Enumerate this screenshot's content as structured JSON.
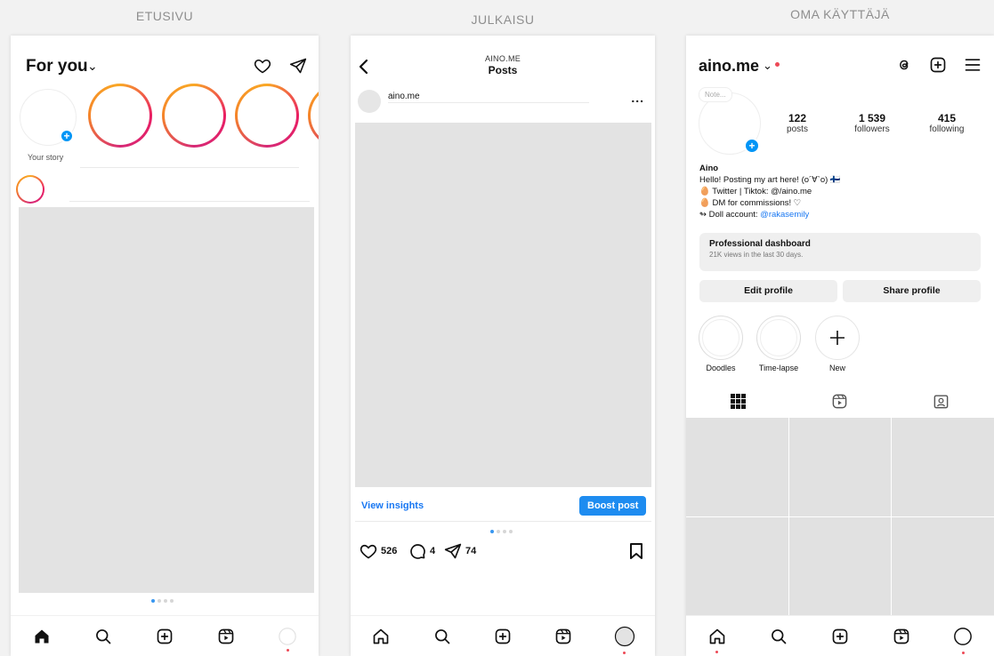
{
  "columns": {
    "home_label": "ETUSIVU",
    "post_label": "JULKAISU",
    "profile_label": "OMA KÄYTTÄJÄ"
  },
  "home": {
    "title": "For you",
    "your_story_label": "Your story",
    "icons": [
      "heart-icon",
      "send-icon",
      "plus-icon"
    ],
    "nav": [
      "home-icon",
      "search-icon",
      "create-icon",
      "reels-icon",
      "profile-icon"
    ]
  },
  "post": {
    "header_small": "AINO.ME",
    "header_big": "Posts",
    "username": "aino.me",
    "menu": "...",
    "view_insights": "View insights",
    "boost_post": "Boost post",
    "likes": "526",
    "comments": "4",
    "shares": "74",
    "accent": "#1e8cf0"
  },
  "profile": {
    "handle": "aino.me",
    "note": "Note...",
    "stats": [
      {
        "num": "122",
        "label": "posts"
      },
      {
        "num": "1 539",
        "label": "followers"
      },
      {
        "num": "415",
        "label": "following"
      }
    ],
    "name": "Aino",
    "bio_line1": "Hello! Posting my art here! (o´∀`o) 🇫🇮",
    "bio_line2": "Twitter | Tiktok: @/aino.me",
    "bio_line3": "DM for commissions! ♡",
    "bio_line4_prefix": "Doll account: ",
    "bio_line4_link": "@rakasemily",
    "dashboard_title": "Professional dashboard",
    "dashboard_sub": "21K views in the last 30 days.",
    "edit_profile": "Edit profile",
    "share_profile": "Share profile",
    "highlights": [
      {
        "label": "Doodles"
      },
      {
        "label": "Time-lapse"
      },
      {
        "label": "New"
      }
    ]
  }
}
